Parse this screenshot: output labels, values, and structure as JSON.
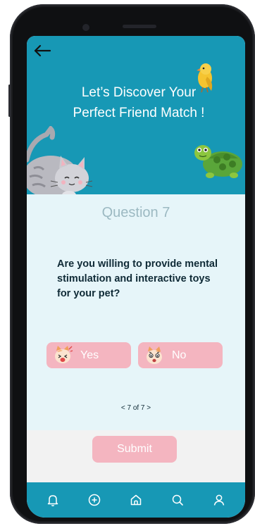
{
  "header": {
    "back_icon": "arrow-left-icon",
    "title_line1": "Let’s Discover Your",
    "title_line2": "Perfect Friend Match !",
    "decorations": [
      "bird-icon",
      "turtle-icon",
      "cat-icon"
    ],
    "background_color": "#1798b5"
  },
  "question": {
    "number_label": "Question 7",
    "text": "Are you willing to provide mental stimulation and interactive toys for your pet?",
    "answers": [
      {
        "label": "Yes",
        "icon": "happy-cat-emoji-icon"
      },
      {
        "label": "No",
        "icon": "sad-cat-emoji-icon"
      }
    ],
    "pagination": "< 7 of 7 >"
  },
  "actions": {
    "submit_label": "Submit",
    "button_color": "#f4b5c0"
  },
  "tabbar": {
    "items": [
      {
        "name": "notifications",
        "icon": "bell-icon"
      },
      {
        "name": "add",
        "icon": "plus-circle-icon"
      },
      {
        "name": "home",
        "icon": "home-icon"
      },
      {
        "name": "search",
        "icon": "search-icon"
      },
      {
        "name": "profile",
        "icon": "user-icon"
      }
    ]
  }
}
